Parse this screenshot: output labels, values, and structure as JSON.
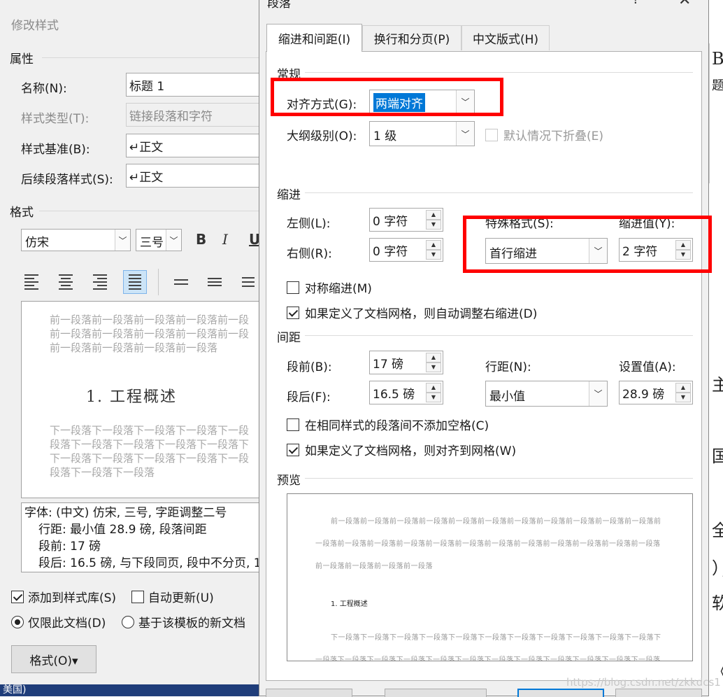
{
  "background_doc": {
    "chars": [
      "B",
      "题",
      "主",
      "国",
      "全",
      "）；",
      "软",
      "《"
    ]
  },
  "style_dialog": {
    "title": "修改样式",
    "properties_label": "属性",
    "name_label": "名称(N):",
    "name_value": "标题 1",
    "type_label": "样式类型(T):",
    "type_value": "链接段落和字符",
    "based_label": "样式基准(B):",
    "based_value": "↵正文",
    "next_label": "后续段落样式(S):",
    "next_value": "↵正文",
    "format_label": "格式",
    "font_value": "仿宋",
    "size_value": "三号",
    "bold": "B",
    "italic": "I",
    "underline": "U",
    "preview": {
      "before_lines": [
        "前一段落前一段落前一段落前一段落前一段",
        "前一段落前一段落前一段落前一段落前一段",
        "前一段落前一段落前一段落前一段落"
      ],
      "heading": "1. 工程概述",
      "after_lines": [
        "下一段落下一段落下一段落下一段落下一段",
        "段落下一段落下一段落下一段落下一段落下",
        "下一段落下一段落下一段落下一段落下一段",
        "段落下一段落下一段落"
      ]
    },
    "description": [
      "字体: (中文) 仿宋, 三号, 字距调整二号",
      "  行距: 最小值 28.9 磅, 段落间距",
      "  段前: 17 磅",
      "  段后: 16.5 磅, 与下段同页, 段中不分页, 1"
    ],
    "add_to_gallery": "添加到样式库(S)",
    "auto_update": "自动更新(U)",
    "only_this_doc": "仅限此文档(D)",
    "new_docs_template": "基于该模板的新文档",
    "format_button": "格式(O)▾",
    "taskbar_text": "美国)"
  },
  "para_dialog": {
    "title": "段落",
    "help": "?",
    "close": "✕",
    "tabs": [
      "缩进和间距(I)",
      "换行和分页(P)",
      "中文版式(H)"
    ],
    "general_label": "常规",
    "alignment_label": "对齐方式(G):",
    "alignment_value": "两端对齐",
    "outline_label": "大纲级别(O):",
    "outline_value": "1 级",
    "collapsed_label": "默认情况下折叠(E)",
    "indent_label": "缩进",
    "left_label": "左侧(L):",
    "left_value": "0 字符",
    "right_label": "右侧(R):",
    "right_value": "0 字符",
    "special_label": "特殊格式(S):",
    "special_value": "首行缩进",
    "indent_by_label": "缩进值(Y):",
    "indent_by_value": "2 字符",
    "mirror_label": "对称缩进(M)",
    "auto_adjust_label": "如果定义了文档网格，则自动调整右缩进(D)",
    "spacing_label": "间距",
    "before_label": "段前(B):",
    "before_value": "17 磅",
    "after_label": "段后(F):",
    "after_value": "16.5 磅",
    "line_label": "行距(N):",
    "line_value": "最小值",
    "at_label": "设置值(A):",
    "at_value": "28.9 磅",
    "no_space_label": "在相同样式的段落间不添加空格(C)",
    "snap_grid_label": "如果定义了文档网格，则对齐到网格(W)",
    "preview_label": "预览",
    "preview": {
      "before_lines": [
        "前一段落前一段落前一段落前一段落前一段落前一段落前一段落前一段落前一段落前一段落前一段落前",
        "一段落前一段落前一段落前一段落前一段落前一段落前一段落前一段落前一段落前一段落前一段落前一段落",
        "前一段落前一段落前一段落前一段落"
      ],
      "heading": "1. 工程概述",
      "after_lines": [
        "下一段落下一段落下一段落下一段落下一段落下一段落下一段落下一段落下一段落下一段落下一段落下",
        "一段落下一段落下一段落下一段落下一段落下一段落下一段落下一段落下一段落下一段落下一段落下一段落"
      ]
    }
  },
  "watermark": "https://blog.csdn.net/zkkdcs1"
}
